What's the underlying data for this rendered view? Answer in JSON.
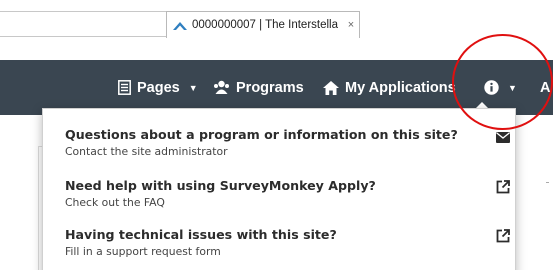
{
  "browser": {
    "tab_title": "0000000007 | The Interstella...",
    "tab_close": "×",
    "icons": [
      "search-icon",
      "lock-icon",
      "refresh-icon",
      "site-favicon"
    ]
  },
  "navbar": {
    "items": [
      {
        "label": "Pages",
        "icon": "document-icon",
        "has_caret": true
      },
      {
        "label": "Programs",
        "icon": "people-icon",
        "has_caret": false
      },
      {
        "label": "My Applications",
        "icon": "home-icon",
        "has_caret": false
      },
      {
        "label": "",
        "icon": "info-icon",
        "has_caret": true
      },
      {
        "label": "A",
        "icon": "",
        "has_caret": false
      }
    ],
    "caret": "▼"
  },
  "help_menu": {
    "items": [
      {
        "title": "Questions about a program or information on this site?",
        "subtitle": "Contact the site administrator",
        "icon": "envelope-icon"
      },
      {
        "title": "Need help with using SurveyMonkey Apply?",
        "subtitle": "Check out the FAQ",
        "icon": "external-link-icon"
      },
      {
        "title": "Having technical issues with this site?",
        "subtitle": "Fill in a support request form",
        "icon": "external-link-icon"
      }
    ]
  },
  "colors": {
    "navbar_bg": "#3a4651",
    "annotation": "#e01010"
  }
}
